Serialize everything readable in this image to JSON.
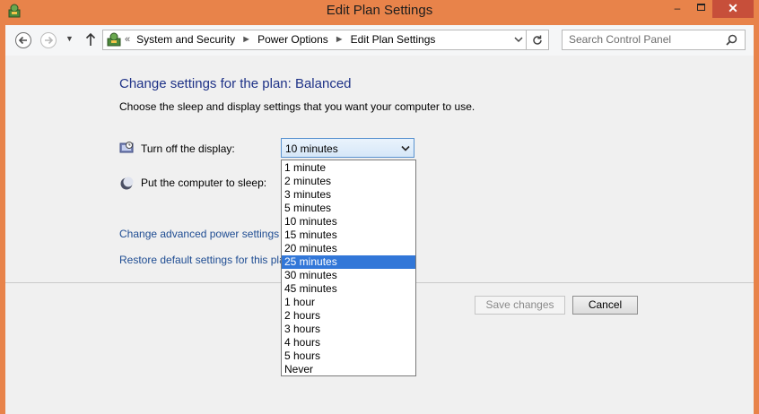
{
  "window": {
    "title": "Edit Plan Settings",
    "controls": {
      "minimize": "–",
      "close": "✕"
    }
  },
  "navbar": {
    "breadcrumb_lead": "«",
    "breadcrumb": [
      "System and Security",
      "Power Options",
      "Edit Plan Settings"
    ],
    "search_placeholder": "Search Control Panel"
  },
  "main": {
    "title": "Change settings for the plan: Balanced",
    "description": "Choose the sleep and display settings that you want your computer to use.",
    "display_label": "Turn off the display:",
    "display_value": "10 minutes",
    "sleep_label": "Put the computer to sleep:",
    "advanced_link": "Change advanced power settings",
    "restore_link": "Restore default settings for this pla"
  },
  "dropdown": {
    "options": [
      "1 minute",
      "2 minutes",
      "3 minutes",
      "5 minutes",
      "10 minutes",
      "15 minutes",
      "20 minutes",
      "25 minutes",
      "30 minutes",
      "45 minutes",
      "1 hour",
      "2 hours",
      "3 hours",
      "4 hours",
      "5 hours",
      "Never"
    ],
    "highlighted": "25 minutes"
  },
  "buttons": {
    "save": "Save changes",
    "cancel": "Cancel"
  },
  "colors": {
    "titlebar": "#e8834a",
    "close_button": "#c74f3a",
    "heading": "#1e3287",
    "link": "#1e4c92",
    "highlight": "#3277d8"
  }
}
